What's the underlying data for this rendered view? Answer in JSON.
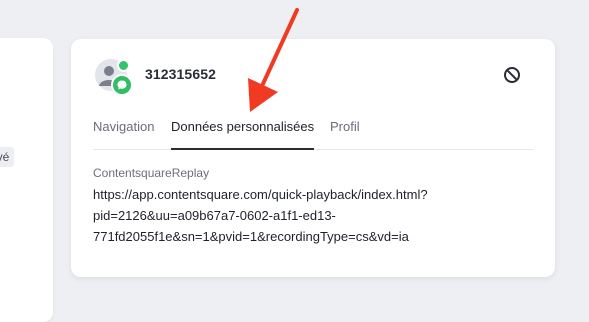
{
  "left_panel": {
    "badge": "Privé"
  },
  "user": {
    "id": "312315652"
  },
  "icons": {
    "avatar": "user-avatar-icon",
    "online": "online-status-dot",
    "chat": "chat-bubble-icon",
    "block": "block-icon"
  },
  "tabs": [
    {
      "label": "Navigation",
      "active": false
    },
    {
      "label": "Données personnalisées",
      "active": true
    },
    {
      "label": "Profil",
      "active": false
    }
  ],
  "custom_data": {
    "label": "ContentsquareReplay",
    "value_lines": [
      "https://app.contentsquare.com/quick-playback/index.html?",
      "pid=2126&uu=a09b67a7-0602-a1f1-ed13-",
      "771fd2055f1e&sn=1&pvid=1&recordingType=cs&vd=ia"
    ]
  },
  "colors": {
    "background": "#eeeff3",
    "card": "#ffffff",
    "accent_green": "#2fbe63",
    "annotation_red": "#f03a22",
    "text_primary": "#1f212b",
    "text_secondary": "#6a6d7a"
  }
}
